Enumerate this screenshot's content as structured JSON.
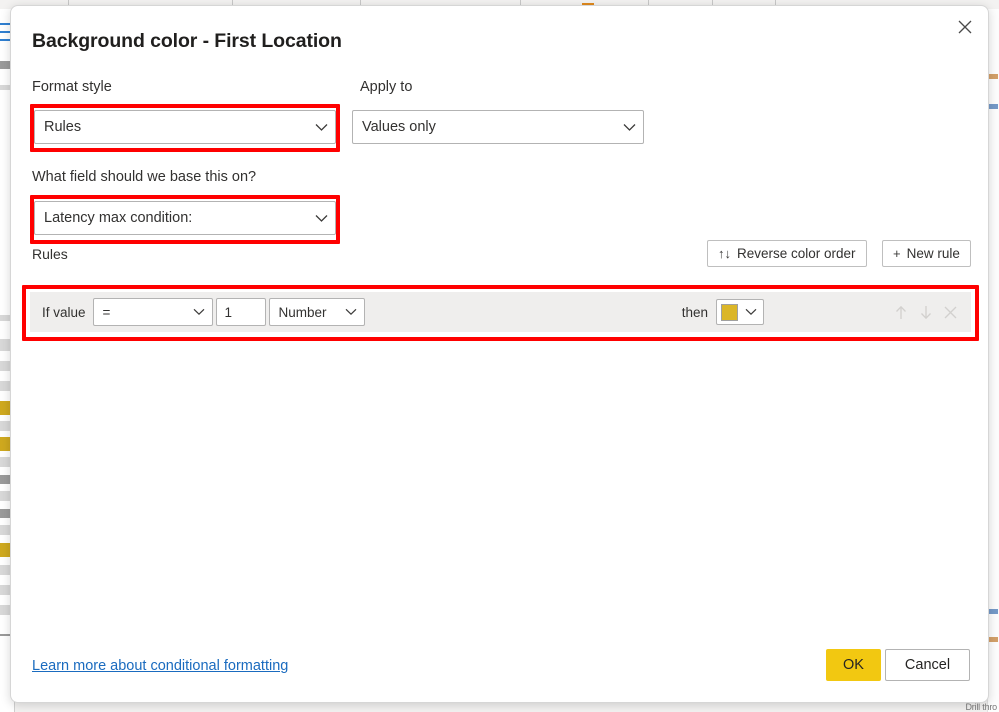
{
  "backdrop": {
    "bottom_right_label": "Drill thro"
  },
  "dialog": {
    "title": "Background color - First Location",
    "close_icon": "close-icon",
    "format_style": {
      "label": "Format style",
      "value": "Rules",
      "chevron_icon": "chevron-down-icon"
    },
    "apply_to": {
      "label": "Apply to",
      "value": "Values only",
      "chevron_icon": "chevron-down-icon"
    },
    "base_field": {
      "label": "What field should we base this on?",
      "value": "Latency max condition:",
      "chevron_icon": "chevron-down-icon"
    },
    "rules_section": {
      "caption": "Rules",
      "reverse_button": {
        "icon": "sort-arrows-icon",
        "glyph": "↑↓",
        "label": "Reverse color order"
      },
      "new_rule_button": {
        "icon": "plus-icon",
        "glyph": "+",
        "label": "New rule"
      },
      "rules": [
        {
          "if_label": "If value",
          "operator": "=",
          "operator_chevron_icon": "chevron-down-icon",
          "threshold": "1",
          "value_type": "Number",
          "value_type_chevron_icon": "chevron-down-icon",
          "then_label": "then",
          "color": "#dbb628",
          "color_chevron_icon": "chevron-down-icon",
          "move_up_icon": "arrow-up-icon",
          "move_down_icon": "arrow-down-icon",
          "remove_icon": "close-icon"
        }
      ]
    },
    "footer": {
      "learn_more_link": "Learn more about conditional formatting",
      "ok_label": "OK",
      "cancel_label": "Cancel"
    }
  },
  "colors": {
    "accent": "#f2c811",
    "highlight": "#ff0000",
    "link": "#1a6bbf",
    "rule_row_bg": "#efeeed"
  }
}
